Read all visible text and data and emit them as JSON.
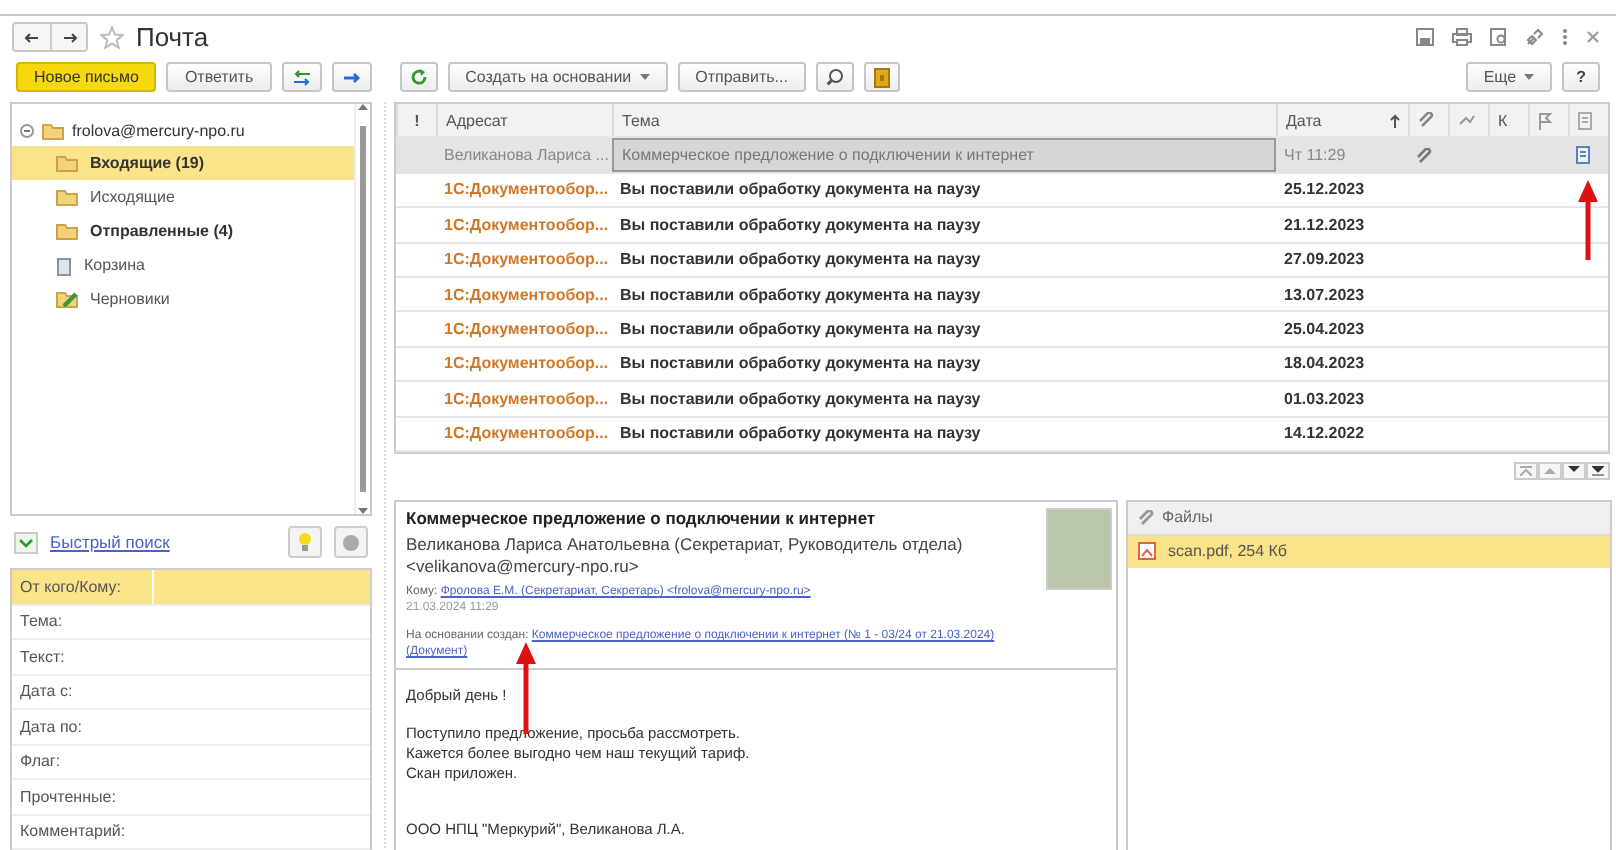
{
  "window": {
    "title": "Почта",
    "favorite": false
  },
  "toolbar": {
    "new_message": "Новое письмо",
    "reply": "Ответить",
    "create_based_on": "Создать на основании",
    "send": "Отправить...",
    "more": "Еще",
    "help": "?"
  },
  "folders": {
    "account": "frolova@mercury-npo.ru",
    "expanded": true,
    "children": [
      {
        "label": "Входящие (19)",
        "kind": "folder",
        "unread": true,
        "selected": true
      },
      {
        "label": "Исходящие",
        "kind": "folder",
        "unread": false,
        "selected": false
      },
      {
        "label": "Отправленные (4)",
        "kind": "folder",
        "unread": true,
        "selected": false
      },
      {
        "label": "Корзина",
        "kind": "trash",
        "unread": false,
        "selected": false
      },
      {
        "label": "Черновики",
        "kind": "drafts",
        "unread": false,
        "selected": false
      }
    ]
  },
  "quick_search": {
    "label": "Быстрый поиск",
    "expanded": true
  },
  "filters": [
    {
      "label": "От кого/Кому:",
      "selected": true
    },
    {
      "label": "Тема:",
      "selected": false
    },
    {
      "label": "Текст:",
      "selected": false
    },
    {
      "label": "Дата с:",
      "selected": false
    },
    {
      "label": "Дата по:",
      "selected": false
    },
    {
      "label": "Флаг:",
      "selected": false
    },
    {
      "label": "Прочтенные:",
      "selected": false
    },
    {
      "label": "Комментарий:",
      "selected": false
    }
  ],
  "messages": {
    "columns": [
      {
        "label": "!",
        "sorted": false
      },
      {
        "label": "Адресат",
        "sorted": false
      },
      {
        "label": "Тема",
        "sorted": false
      },
      {
        "label": "Дата",
        "sorted": true
      },
      {
        "label": "К",
        "sorted": false
      }
    ],
    "rows": [
      {
        "recipient": "Великанова Лариса ...",
        "subject": "Коммерческое предложение о подключении к интернет",
        "date": "Чт 11:29",
        "unread": false,
        "selected": true,
        "attachment": true,
        "linked_document": true
      },
      {
        "recipient": "1С:Документообор...",
        "subject": "Вы поставили обработку документа на паузу",
        "date": "25.12.2023",
        "unread": true,
        "selected": false,
        "attachment": false,
        "linked_document": false
      },
      {
        "recipient": "1С:Документообор...",
        "subject": "Вы поставили обработку документа на паузу",
        "date": "21.12.2023",
        "unread": true,
        "selected": false,
        "attachment": false,
        "linked_document": false
      },
      {
        "recipient": "1С:Документообор...",
        "subject": "Вы поставили обработку документа на паузу",
        "date": "27.09.2023",
        "unread": true,
        "selected": false,
        "attachment": false,
        "linked_document": false
      },
      {
        "recipient": "1С:Документообор...",
        "subject": "Вы поставили обработку документа на паузу",
        "date": "13.07.2023",
        "unread": true,
        "selected": false,
        "attachment": false,
        "linked_document": false
      },
      {
        "recipient": "1С:Документообор...",
        "subject": "Вы поставили обработку документа на паузу",
        "date": "25.04.2023",
        "unread": true,
        "selected": false,
        "attachment": false,
        "linked_document": false
      },
      {
        "recipient": "1С:Документообор...",
        "subject": "Вы поставили обработку документа на паузу",
        "date": "18.04.2023",
        "unread": true,
        "selected": false,
        "attachment": false,
        "linked_document": false
      },
      {
        "recipient": "1С:Документообор...",
        "subject": "Вы поставили обработку документа на паузу",
        "date": "01.03.2023",
        "unread": true,
        "selected": false,
        "attachment": false,
        "linked_document": false
      },
      {
        "recipient": "1С:Документообор...",
        "subject": "Вы поставили обработку документа на паузу",
        "date": "14.12.2022",
        "unread": true,
        "selected": false,
        "attachment": false,
        "linked_document": false
      }
    ]
  },
  "preview": {
    "subject": "Коммерческое предложение о подключении к интернет",
    "sender": "Великанова Лариса Анатольевна (Секретариат, Руководитель отдела)",
    "sender_email": "<velikanova@mercury-npo.ru>",
    "to_label": "Кому:",
    "to": "Фролова Е.М. (Секретариат, Секретарь) <frolova@mercury-npo.ru>",
    "date": "21.03.2024 11:29",
    "based_on_label": "На основании создан:",
    "based_on": "Коммерческое предложение о подключении к интернет (№ 1 - 03/24 от 21.03.2024)",
    "based_on_2": "(Документ)",
    "body": [
      [
        "Добрый день !"
      ],
      [
        "Поступило предложение, просьба рассмотреть.",
        "Кажется более выгодно чем наш текущий тариф.",
        "Скан приложен."
      ],
      [
        "ООО НПЦ \"Меркурий\", Великанова Л.А."
      ]
    ]
  },
  "files": {
    "title": "Файлы",
    "items": [
      {
        "name": "scan.pdf, 254 Кб",
        "selected": true
      }
    ]
  }
}
